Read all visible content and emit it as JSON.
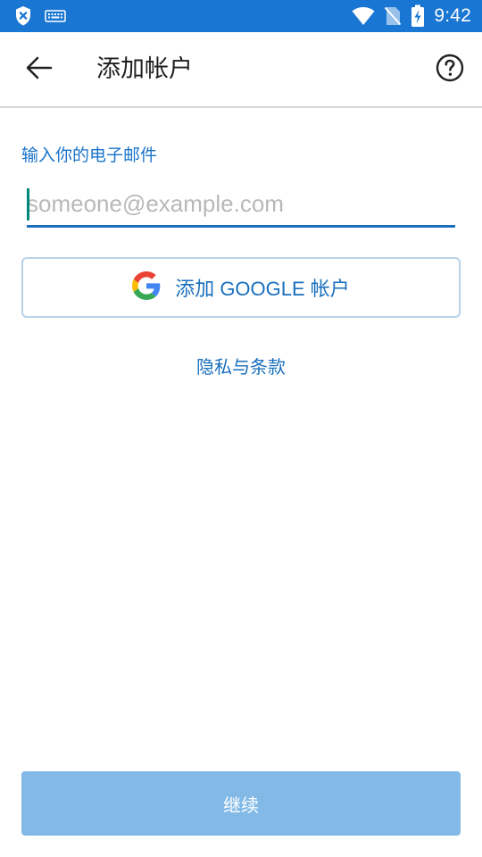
{
  "status_bar": {
    "time": "9:42",
    "icons": [
      "shield-x-icon",
      "keyboard-icon",
      "wifi-icon",
      "no-sim-icon",
      "battery-charging-icon"
    ],
    "color": "#1976d2"
  },
  "app_bar": {
    "title": "添加帐户",
    "back_icon": "arrow-left-icon",
    "help_icon": "help-circle-icon"
  },
  "form": {
    "email_label": "输入你的电子邮件",
    "email_value": "",
    "email_placeholder": "someone@example.com",
    "google_button_label": "添加 GOOGLE 帐户",
    "google_icon": "google-g-icon",
    "privacy_link": "隐私与条款"
  },
  "footer": {
    "continue_label": "继续",
    "continue_color": "#82b9e6"
  },
  "colors": {
    "accent": "#1a6fbd",
    "label": "#1a73c9",
    "caret": "#00897b"
  }
}
